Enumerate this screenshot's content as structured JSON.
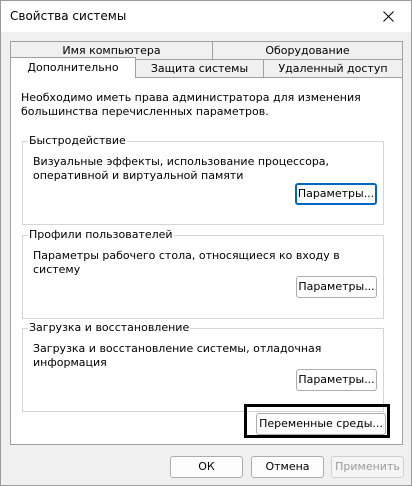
{
  "window": {
    "title": "Свойства системы"
  },
  "tabs": {
    "row1": [
      {
        "label": "Имя компьютера"
      },
      {
        "label": "Оборудование"
      }
    ],
    "row2": [
      {
        "label": "Дополнительно",
        "active": true
      },
      {
        "label": "Защита системы"
      },
      {
        "label": "Удаленный доступ"
      }
    ]
  },
  "panel": {
    "intro": "Необходимо иметь права администратора для изменения большинства перечисленных параметров.",
    "performance": {
      "title": "Быстродействие",
      "description": "Визуальные эффекты, использование процессора, оперативной и виртуальной памяти",
      "button": "Параметры..."
    },
    "profiles": {
      "title": "Профили пользователей",
      "description": "Параметры рабочего стола, относящиеся ко входу в систему",
      "button": "Параметры..."
    },
    "startup": {
      "title": "Загрузка и восстановление",
      "description": "Загрузка и восстановление системы, отладочная информация",
      "button": "Параметры..."
    },
    "env_button": "Переменные среды..."
  },
  "footer": {
    "ok": "ОК",
    "cancel": "Отмена",
    "apply": "Применить"
  },
  "icons": {
    "close": "close-icon"
  },
  "colors": {
    "focus_border": "#0067c0",
    "window_bg": "#f0f0f0",
    "panel_bg": "#ffffff"
  }
}
